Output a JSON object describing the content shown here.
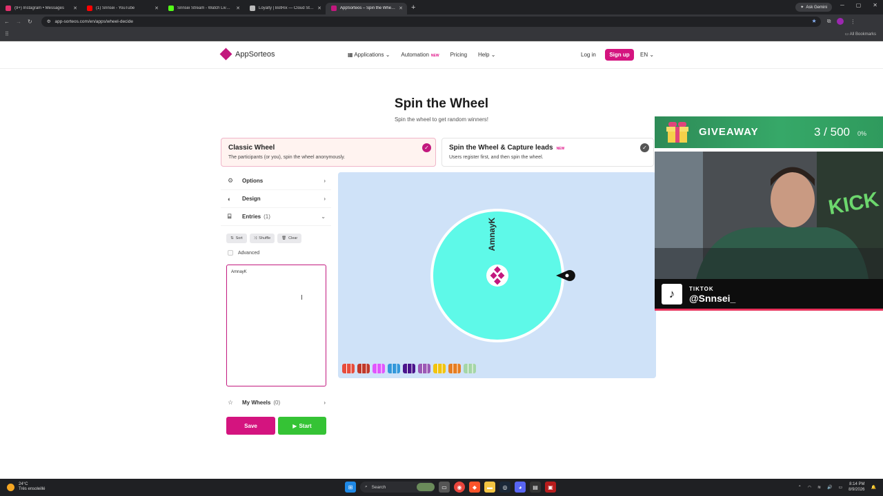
{
  "browser": {
    "tabs": [
      {
        "title": "(9+) Instagram • Messages",
        "color": "#e1306c"
      },
      {
        "title": "(1) Snnsei - YouTube",
        "color": "#ff0000"
      },
      {
        "title": "Snnsei Stream - Watch Live on Kick",
        "color": "#53fc18"
      },
      {
        "title": "Loyalty | BotRix — Cloud Stream...",
        "color": "#bbbbbb"
      },
      {
        "title": "AppSorteos – Spin the Wheel (1...",
        "color": "#c2187e"
      }
    ],
    "ask_gemini": "Ask Gemini",
    "url": "app-sorteos.com/en/apps/wheel-decide",
    "all_bookmarks": "All Bookmarks"
  },
  "site": {
    "logo_text": "AppSorteos",
    "nav": {
      "applications": "Applications",
      "automation": "Automation",
      "new_badge": "NEW",
      "pricing": "Pricing",
      "help": "Help"
    },
    "login": "Log in",
    "signup": "Sign up",
    "lang": "EN"
  },
  "page": {
    "title": "Spin the Wheel",
    "subtitle": "Spin the wheel to get random winners!",
    "modes": [
      {
        "title": "Classic Wheel",
        "desc": "The participants (or you), spin the wheel anonymously."
      },
      {
        "title": "Spin the Wheel & Capture leads",
        "badge": "NEW",
        "desc": "Users register first, and then spin the wheel."
      }
    ],
    "sidebar": {
      "options": "Options",
      "design": "Design",
      "entries": "Entries",
      "entries_count": "(1)",
      "tools": {
        "sort": "Sort",
        "shuffle": "Shuffle",
        "clear": "Clear"
      },
      "advanced": "Advanced",
      "entries_text": "AmnayK",
      "my_wheels": "My Wheels",
      "my_wheels_count": "(0)"
    },
    "save": "Save",
    "start": "Start",
    "wheel": {
      "entry": "AmnayK",
      "slice_color": "#5ef9e8",
      "bg_color": "#cfe2f8"
    },
    "swatch_colors": [
      "#e74c3c",
      "#c0392b",
      "#e056fd",
      "#3498db",
      "#4a148c",
      "#9b59b6",
      "#f1c40f",
      "#e67e22",
      "#a5d6a7",
      "#f48fb1",
      "#27ae60",
      "#16a085"
    ]
  },
  "overlay": {
    "giveaway_label": "GIVEAWAY",
    "giveaway_count": "3 / 500",
    "giveaway_pct": "0%",
    "tiktok_label": "TIKTOK",
    "tiktok_handle": "@Snnsei_"
  },
  "taskbar": {
    "temp": "24°C",
    "weather": "Très ensoleillé",
    "search": "Search",
    "time": "8:14 PM",
    "date": "8/9/2026"
  }
}
